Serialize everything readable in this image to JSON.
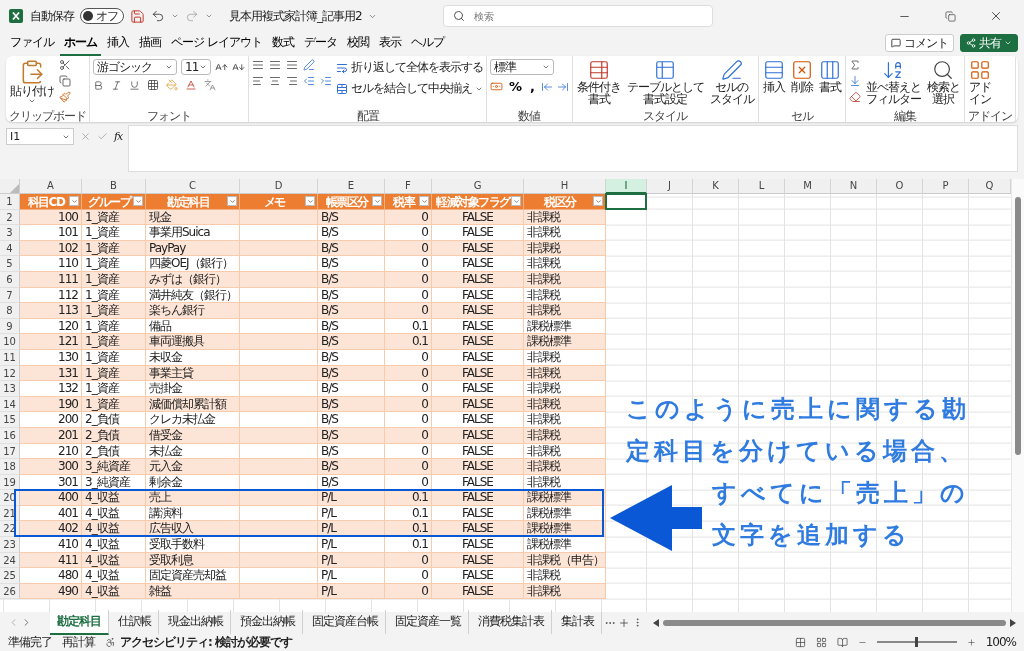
{
  "title_bar": {
    "autosave_label": "自動保存",
    "autosave": {
      "on": false,
      "label": "オフ"
    },
    "filename": "見本用複式家計簿_記事用2",
    "search": {
      "placeholder": "検索"
    }
  },
  "menu_tabs": [
    {
      "label": "ファイル",
      "selected": false
    },
    {
      "label": "ホーム",
      "selected": true
    },
    {
      "label": "挿入",
      "selected": false
    },
    {
      "label": "描画",
      "selected": false
    },
    {
      "label": "ページ レイアウト",
      "selected": false
    },
    {
      "label": "数式",
      "selected": false
    },
    {
      "label": "データ",
      "selected": false
    },
    {
      "label": "校閲",
      "selected": false
    },
    {
      "label": "表示",
      "selected": false
    },
    {
      "label": "ヘルプ",
      "selected": false
    }
  ],
  "actions": {
    "comment": "コメント",
    "share": "共有"
  },
  "ribbon": {
    "groups": [
      {
        "kind": "clipboard",
        "label": "クリップボード",
        "paste": "貼り付け"
      },
      {
        "kind": "font",
        "label": "フォント",
        "font_name": "游ゴシック",
        "font_size": "11"
      },
      {
        "kind": "alignment",
        "label": "配置",
        "wrap": "折り返して全体を表示する",
        "merge": "セルを結合して中央揃え"
      },
      {
        "kind": "number",
        "label": "数値",
        "format": "標準",
        "percent": "%",
        "comma": ","
      },
      {
        "kind": "buttons",
        "label": "スタイル",
        "buttons": [
          [
            "条件付き",
            "書式"
          ],
          [
            "テーブルとして",
            "書式設定"
          ],
          [
            "セルの",
            "スタイル"
          ]
        ]
      },
      {
        "kind": "buttons",
        "label": "セル",
        "buttons": [
          [
            "挿入"
          ],
          [
            "削除"
          ],
          [
            "書式"
          ]
        ]
      },
      {
        "kind": "editing",
        "label": "編集",
        "buttons": [
          [
            "並べ替えと",
            "フィルター"
          ],
          [
            "検索と",
            "選択"
          ]
        ]
      },
      {
        "kind": "buttons",
        "label": "アドイン",
        "buttons": [
          [
            "アド",
            "イン"
          ]
        ]
      }
    ]
  },
  "formula_bar": {
    "name_box": "I1",
    "function_label": "fx"
  },
  "columns": [
    {
      "label": "A",
      "selected": false
    },
    {
      "label": "B",
      "selected": false
    },
    {
      "label": "C",
      "selected": false
    },
    {
      "label": "D",
      "selected": false
    },
    {
      "label": "E",
      "selected": false
    },
    {
      "label": "F",
      "selected": false
    },
    {
      "label": "G",
      "selected": false
    },
    {
      "label": "H",
      "selected": false
    },
    {
      "label": "I",
      "selected": true
    },
    {
      "label": "J",
      "selected": false
    },
    {
      "label": "K",
      "selected": false
    },
    {
      "label": "L",
      "selected": false
    },
    {
      "label": "M",
      "selected": false
    },
    {
      "label": "N",
      "selected": false
    },
    {
      "label": "O",
      "selected": false
    },
    {
      "label": "P",
      "selected": false
    },
    {
      "label": "Q",
      "selected": false
    }
  ],
  "header_row": {
    "number": "1",
    "labels": [
      "科目CD",
      "グループ",
      "勘定科目",
      "メモ",
      "帳票区分",
      "税率",
      "軽減対象フラグ",
      "税区分"
    ]
  },
  "rows": [
    {
      "number": "2",
      "code": "100",
      "group": "1_資産",
      "account": "現金",
      "book": "B/S",
      "rate": "0",
      "reduced": "FALSE",
      "tax": "非課税",
      "highlighted": false
    },
    {
      "number": "3",
      "code": "101",
      "group": "1_資産",
      "account": "事業用Suica",
      "book": "B/S",
      "rate": "0",
      "reduced": "FALSE",
      "tax": "非課税",
      "highlighted": false
    },
    {
      "number": "4",
      "code": "102",
      "group": "1_資産",
      "account": "PayPay",
      "book": "B/S",
      "rate": "0",
      "reduced": "FALSE",
      "tax": "非課税",
      "highlighted": false
    },
    {
      "number": "5",
      "code": "110",
      "group": "1_資産",
      "account": "四菱OEJ（銀行）",
      "book": "B/S",
      "rate": "0",
      "reduced": "FALSE",
      "tax": "非課税",
      "highlighted": false
    },
    {
      "number": "6",
      "code": "111",
      "group": "1_資産",
      "account": "みずは（銀行）",
      "book": "B/S",
      "rate": "0",
      "reduced": "FALSE",
      "tax": "非課税",
      "highlighted": false
    },
    {
      "number": "7",
      "code": "112",
      "group": "1_資産",
      "account": "満井純友（銀行）",
      "book": "B/S",
      "rate": "0",
      "reduced": "FALSE",
      "tax": "非課税",
      "highlighted": false
    },
    {
      "number": "8",
      "code": "113",
      "group": "1_資産",
      "account": "楽ちん銀行",
      "book": "B/S",
      "rate": "0",
      "reduced": "FALSE",
      "tax": "非課税",
      "highlighted": false
    },
    {
      "number": "9",
      "code": "120",
      "group": "1_資産",
      "account": "備品",
      "book": "B/S",
      "rate": "0.1",
      "reduced": "FALSE",
      "tax": "課税標準",
      "highlighted": false
    },
    {
      "number": "10",
      "code": "121",
      "group": "1_資産",
      "account": "車両運搬具",
      "book": "B/S",
      "rate": "0.1",
      "reduced": "FALSE",
      "tax": "課税標準",
      "highlighted": false
    },
    {
      "number": "11",
      "code": "130",
      "group": "1_資産",
      "account": "未収金",
      "book": "B/S",
      "rate": "0",
      "reduced": "FALSE",
      "tax": "非課税",
      "highlighted": false
    },
    {
      "number": "12",
      "code": "131",
      "group": "1_資産",
      "account": "事業主貸",
      "book": "B/S",
      "rate": "0",
      "reduced": "FALSE",
      "tax": "非課税",
      "highlighted": false
    },
    {
      "number": "13",
      "code": "132",
      "group": "1_資産",
      "account": "売掛金",
      "book": "B/S",
      "rate": "0",
      "reduced": "FALSE",
      "tax": "非課税",
      "highlighted": false
    },
    {
      "number": "14",
      "code": "190",
      "group": "1_資産",
      "account": "減価償却累計額",
      "book": "B/S",
      "rate": "0",
      "reduced": "FALSE",
      "tax": "非課税",
      "highlighted": false
    },
    {
      "number": "15",
      "code": "200",
      "group": "2_負債",
      "account": "クレカ未払金",
      "book": "B/S",
      "rate": "0",
      "reduced": "FALSE",
      "tax": "非課税",
      "highlighted": false
    },
    {
      "number": "16",
      "code": "201",
      "group": "2_負債",
      "account": "借受金",
      "book": "B/S",
      "rate": "0",
      "reduced": "FALSE",
      "tax": "非課税",
      "highlighted": false
    },
    {
      "number": "17",
      "code": "210",
      "group": "2_負債",
      "account": "未払金",
      "book": "B/S",
      "rate": "0",
      "reduced": "FALSE",
      "tax": "非課税",
      "highlighted": false
    },
    {
      "number": "18",
      "code": "300",
      "group": "3_純資産",
      "account": "元入金",
      "book": "B/S",
      "rate": "0",
      "reduced": "FALSE",
      "tax": "非課税",
      "highlighted": false
    },
    {
      "number": "19",
      "code": "301",
      "group": "3_純資産",
      "account": "剰余金",
      "book": "B/S",
      "rate": "0",
      "reduced": "FALSE",
      "tax": "非課税",
      "highlighted": false
    },
    {
      "number": "20",
      "code": "400",
      "group": "4_収益",
      "account": "売上",
      "book": "P/L",
      "rate": "0.1",
      "reduced": "FALSE",
      "tax": "課税標準",
      "highlighted": true
    },
    {
      "number": "21",
      "code": "401",
      "group": "4_収益",
      "account": "講演料",
      "book": "P/L",
      "rate": "0.1",
      "reduced": "FALSE",
      "tax": "課税標準",
      "highlighted": true
    },
    {
      "number": "22",
      "code": "402",
      "group": "4_収益",
      "account": "広告収入",
      "book": "P/L",
      "rate": "0.1",
      "reduced": "FALSE",
      "tax": "課税標準",
      "highlighted": true
    },
    {
      "number": "23",
      "code": "410",
      "group": "4_収益",
      "account": "受取手数料",
      "book": "P/L",
      "rate": "0.1",
      "reduced": "FALSE",
      "tax": "課税標準",
      "highlighted": false
    },
    {
      "number": "24",
      "code": "411",
      "group": "4_収益",
      "account": "受取利息",
      "book": "P/L",
      "rate": "0",
      "reduced": "FALSE",
      "tax": "非課税（申告）",
      "highlighted": false
    },
    {
      "number": "25",
      "code": "480",
      "group": "4_収益",
      "account": "固定資産売却益",
      "book": "P/L",
      "rate": "0",
      "reduced": "FALSE",
      "tax": "非課税",
      "highlighted": false
    },
    {
      "number": "26",
      "code": "490",
      "group": "4_収益",
      "account": "雑益",
      "book": "P/L",
      "rate": "0",
      "reduced": "FALSE",
      "tax": "非課税",
      "highlighted": false
    }
  ],
  "annotation": {
    "paragraphs": [
      [
        "このように売上に関する勘",
        "定科目を分けている場合、"
      ],
      [
        "すべてに「売上」の",
        "文字を追加する"
      ]
    ]
  },
  "sheet_tabs": [
    {
      "label": "勘定科目",
      "selected": true
    },
    {
      "label": "仕訳帳",
      "selected": false
    },
    {
      "label": "現金出納帳",
      "selected": false
    },
    {
      "label": "預金出納帳",
      "selected": false
    },
    {
      "label": "固定資産台帳",
      "selected": false
    },
    {
      "label": "固定資産一覧",
      "selected": false
    },
    {
      "label": "消費税集計表",
      "selected": false
    },
    {
      "label": "集計表",
      "selected": false
    }
  ],
  "status_bar": {
    "ready": "準備完了",
    "recalc": "再計算",
    "accessibility": "アクセシビリティ: 検討が必要です",
    "zoom": {
      "level": 0.5,
      "label": "100%"
    }
  }
}
